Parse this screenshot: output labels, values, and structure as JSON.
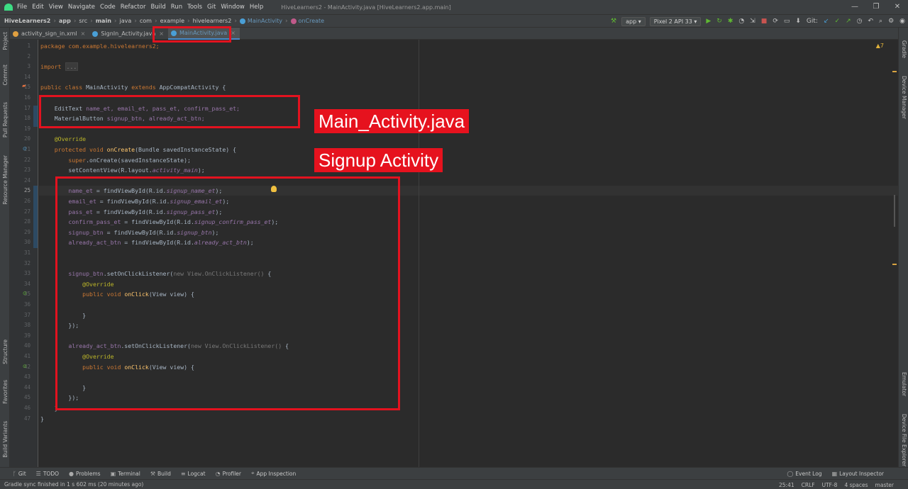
{
  "window": {
    "title": "HiveLearners2 - MainActivity.java [HiveLearners2.app.main]",
    "controls": [
      "—",
      "❐",
      "✕"
    ]
  },
  "menu": [
    "File",
    "Edit",
    "View",
    "Navigate",
    "Code",
    "Refactor",
    "Build",
    "Run",
    "Tools",
    "Git",
    "Window",
    "Help"
  ],
  "breadcrumb": [
    "HiveLearners2",
    "app",
    "src",
    "main",
    "java",
    "com",
    "example",
    "hivelearners2",
    "MainActivity",
    "onCreate"
  ],
  "toolbar": {
    "run_config": "app",
    "device": "Pixel 2 API 33",
    "git_label": "Git:"
  },
  "tabs": [
    {
      "label": "activity_sign_in.xml",
      "color": "#e0a040"
    },
    {
      "label": "SignIn_Activity.java",
      "color": "#4a9fd6"
    },
    {
      "label": "MainActivity.java",
      "color": "#4a9fd6"
    }
  ],
  "left_tools": [
    "Project",
    "Commit",
    "Pull Requests",
    "Resource Manager",
    "Structure",
    "Favorites",
    "Build Variants"
  ],
  "right_tools": [
    "Gradle",
    "Device Manager",
    "Emulator",
    "Device File Explorer"
  ],
  "editor": {
    "warnings": "▲7",
    "line_numbers": [
      "1",
      "2",
      "3",
      "14",
      "15",
      "16",
      "17",
      "18",
      "19",
      "20",
      "21",
      "22",
      "23",
      "24",
      "25",
      "26",
      "27",
      "28",
      "29",
      "30",
      "31",
      "32",
      "33",
      "34",
      "35",
      "36",
      "37",
      "38",
      "39",
      "40",
      "41",
      "42",
      "43",
      "44",
      "45",
      "46",
      "47"
    ],
    "code": {
      "l1": "package com.example.hivelearners2;",
      "l3a": "import",
      "l3b": "...",
      "l15a": "public class ",
      "l15b": "MainActivity ",
      "l15c": "extends ",
      "l15d": "AppCompatActivity {",
      "l17a": "    EditText ",
      "l17b": "name_et, email_et, pass_et, confirm_pass_et;",
      "l18a": "    MaterialButton ",
      "l18b": "signup_btn, already_act_btn;",
      "l20": "    @Override",
      "l21a": "    protected void ",
      "l21b": "onCreate",
      "l21c": "(Bundle savedInstanceState) {",
      "l22a": "        super",
      "l22b": ".onCreate(savedInstanceState);",
      "l23a": "        setContentView(R.layout.",
      "l23b": "activity_main",
      "l23c": ");",
      "l25a": "        name_et",
      "l25b": " = findViewById(R.id.",
      "l25c": "signup_name_et",
      "l25d": ");",
      "l26a": "        email_et",
      "l26b": " = findViewById(R.id.",
      "l26c": "signup_email_et",
      "l26d": ");",
      "l27a": "        pass_et",
      "l27b": " = findViewById(R.id.",
      "l27c": "signup_pass_et",
      "l27d": ");",
      "l28a": "        confirm_pass_et",
      "l28b": " = findViewById(R.id.",
      "l28c": "signup_confirm_pass_et",
      "l28d": ");",
      "l29a": "        signup_btn",
      "l29b": " = findViewById(R.id.",
      "l29c": "signup_btn",
      "l29d": ");",
      "l30a": "        already_act_btn",
      "l30b": " = findViewById(R.id.",
      "l30c": "already_act_btn",
      "l30d": ");",
      "l33a": "        signup_btn",
      "l33b": ".setOnClickListener(",
      "l33c": "new View.OnClickListener() ",
      "l33d": "{",
      "l34": "            @Override",
      "l35a": "            public void ",
      "l35b": "onClick",
      "l35c": "(View view) {",
      "l37": "            }",
      "l38": "        });",
      "l40a": "        already_act_btn",
      "l40b": ".setOnClickListener(",
      "l40c": "new View.OnClickListener() ",
      "l40d": "{",
      "l41": "            @Override",
      "l42a": "            public void ",
      "l42b": "onClick",
      "l42c": "(View view) {",
      "l44": "            }",
      "l45": "        });",
      "l46": "    }",
      "l47": "}"
    }
  },
  "annotations": {
    "main_activity": "Main_Activity.java",
    "signup_activity": "Signup Activity"
  },
  "bottom_tools": [
    "Git",
    "TODO",
    "Problems",
    "Terminal",
    "Build",
    "Logcat",
    "Profiler",
    "App Inspection"
  ],
  "bottom_right_tools": [
    "Event Log",
    "Layout Inspector"
  ],
  "status": {
    "message": "Gradle sync finished in 1 s 602 ms (20 minutes ago)",
    "position": "25:41",
    "line_sep": "CRLF",
    "encoding": "UTF-8",
    "indent": "4 spaces",
    "branch": "master"
  }
}
